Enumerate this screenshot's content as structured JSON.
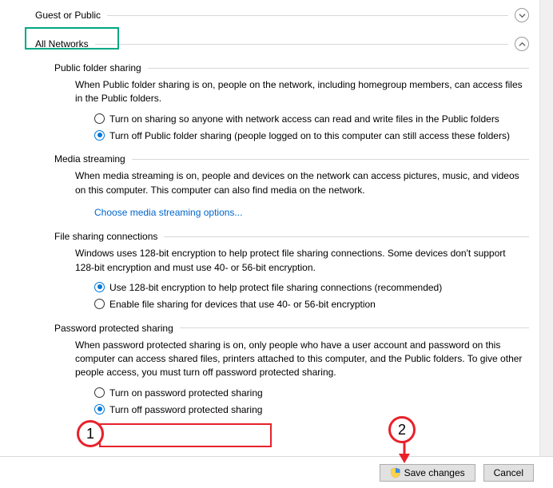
{
  "profiles": {
    "guest": {
      "title": "Guest or Public"
    },
    "all": {
      "title": "All Networks"
    }
  },
  "sections": {
    "publicFolder": {
      "title": "Public folder sharing",
      "desc": "When Public folder sharing is on, people on the network, including homegroup members, can access files in the Public folders.",
      "opt_on": "Turn on sharing so anyone with network access can read and write files in the Public folders",
      "opt_off": "Turn off Public folder sharing (people logged on to this computer can still access these folders)"
    },
    "media": {
      "title": "Media streaming",
      "desc": "When media streaming is on, people and devices on the network can access pictures, music, and videos on this computer. This computer can also find media on the network.",
      "link": "Choose media streaming options..."
    },
    "fileConn": {
      "title": "File sharing connections",
      "desc": "Windows uses 128-bit encryption to help protect file sharing connections. Some devices don't support 128-bit encryption and must use 40- or 56-bit encryption.",
      "opt_128": "Use 128-bit encryption to help protect file sharing connections (recommended)",
      "opt_4056": "Enable file sharing for devices that use 40- or 56-bit encryption"
    },
    "password": {
      "title": "Password protected sharing",
      "desc": "When password protected sharing is on, only people who have a user account and password on this computer can access shared files, printers attached to this computer, and the Public folders. To give other people access, you must turn off password protected sharing.",
      "opt_on": "Turn on password protected sharing",
      "opt_off": "Turn off password protected sharing"
    }
  },
  "footer": {
    "save": "Save changes",
    "cancel": "Cancel"
  },
  "annotations": {
    "badge1": "1",
    "badge2": "2"
  }
}
